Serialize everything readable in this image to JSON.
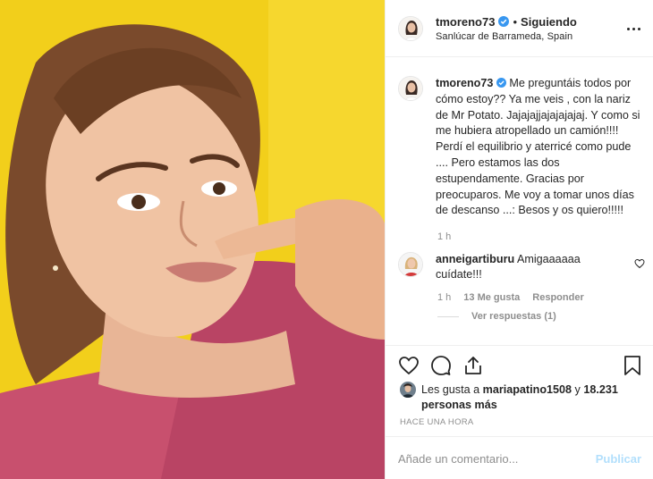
{
  "header": {
    "username": "tmoreno73",
    "separator": "•",
    "follow_status": "Siguiendo",
    "location": "Sanlúcar de Barrameda, Spain"
  },
  "caption": {
    "username": "tmoreno73",
    "text": "Me preguntáis todos por cómo estoy?? Ya me veis , con la nariz de Mr Potato. Jajajajjajajajajaj. Y como si me hubiera atropellado un camión!!!! Perdí el equilibrio y aterricé como pude .... Pero estamos las dos estupendamente. Gracias por preocuparos. Me voy a tomar unos días de descanso ...: Besos y os quiero!!!!!",
    "time": "1 h"
  },
  "comment": {
    "username": "anneigartiburu",
    "text": "Amigaaaaaa cuídate!!!",
    "time": "1 h",
    "likes": "13 Me gusta",
    "reply": "Responder",
    "view_replies": "Ver respuestas (1)"
  },
  "likes": {
    "prefix": "Les gusta a",
    "user": "mariapatino1508",
    "conj": "y",
    "others": "18.231 personas más"
  },
  "time_ago": "HACE UNA HORA",
  "add_comment": {
    "placeholder": "Añade un comentario...",
    "publish": "Publicar"
  },
  "colors": {
    "verified": "#3897f0",
    "photo_background": "#f2cf1b",
    "shirt": "#c8506e",
    "publish_disabled": "#b2dffc"
  },
  "icons": {
    "like": "heart-icon",
    "comment": "speech-bubble-icon",
    "share": "share-icon",
    "save": "bookmark-icon",
    "more": "ellipsis-icon"
  }
}
